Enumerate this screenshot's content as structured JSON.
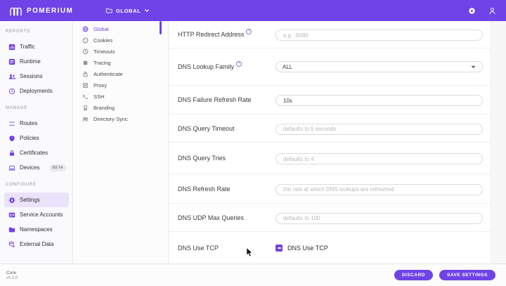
{
  "colors": {
    "accent": "#6F43E7",
    "accent_soft": "#EAE3FB"
  },
  "header": {
    "brand": "POMERIUM",
    "logo_icon": "pomerium-logo-icon",
    "namespace": {
      "icon": "folder-icon",
      "label": "GLOBAL",
      "chevron": "chevron-down-icon"
    },
    "actions": [
      {
        "icon": "gear-icon"
      },
      {
        "icon": "user-icon"
      }
    ]
  },
  "sidebar": {
    "sections": [
      {
        "label": "REPORTS",
        "items": [
          {
            "label": "Traffic",
            "icon": "traffic-icon"
          },
          {
            "label": "Runtime",
            "icon": "runtime-icon"
          },
          {
            "label": "Sessions",
            "icon": "sessions-icon"
          },
          {
            "label": "Deployments",
            "icon": "deployments-icon"
          }
        ]
      },
      {
        "label": "MANAGE",
        "items": [
          {
            "label": "Routes",
            "icon": "routes-icon"
          },
          {
            "label": "Policies",
            "icon": "policies-icon"
          },
          {
            "label": "Certificates",
            "icon": "certificates-icon"
          },
          {
            "label": "Devices",
            "icon": "devices-icon",
            "badge": "BETA"
          }
        ]
      },
      {
        "label": "CONFIGURE",
        "items": [
          {
            "label": "Settings",
            "icon": "settings-icon",
            "active": true
          },
          {
            "label": "Service Accounts",
            "icon": "service-accounts-icon"
          },
          {
            "label": "Namespaces",
            "icon": "namespaces-icon"
          },
          {
            "label": "External Data",
            "icon": "external-data-icon"
          }
        ]
      }
    ],
    "footer": {
      "edition": "Core",
      "version": "v0.0.0"
    }
  },
  "settings_nav": {
    "items": [
      {
        "label": "Global",
        "icon": "globe-icon",
        "active": true
      },
      {
        "label": "Cookies",
        "icon": "cookie-icon"
      },
      {
        "label": "Timeouts",
        "icon": "clock-icon"
      },
      {
        "label": "Tracing",
        "icon": "tracing-icon"
      },
      {
        "label": "Authenticate",
        "icon": "lock-icon"
      },
      {
        "label": "Proxy",
        "icon": "proxy-icon"
      },
      {
        "label": "SSH",
        "icon": "terminal-icon"
      },
      {
        "label": "Branding",
        "icon": "branding-icon"
      },
      {
        "label": "Directory Sync",
        "icon": "people-icon"
      }
    ]
  },
  "form": {
    "rows": [
      {
        "label": "HTTP Redirect Address",
        "info": true,
        "control": "input",
        "placeholder": "e.g. :8080",
        "value": ""
      },
      {
        "label": "DNS Lookup Family",
        "info": true,
        "control": "select",
        "value": "ALL"
      },
      {
        "label": "DNS Failure Refresh Rate",
        "control": "input",
        "placeholder": "",
        "value": "10s"
      },
      {
        "label": "DNS Query Timeout",
        "control": "input",
        "placeholder": "defaults to 5 seconds",
        "value": ""
      },
      {
        "label": "DNS Query Tries",
        "control": "input",
        "placeholder": "defaults to 4",
        "value": ""
      },
      {
        "label": "DNS Refresh Rate",
        "control": "input",
        "placeholder": "the rate at which DNS lookups are refreshed",
        "value": ""
      },
      {
        "label": "DNS UDP Max Queries",
        "control": "input",
        "placeholder": "defaults to 100",
        "value": ""
      },
      {
        "label": "DNS Use TCP",
        "control": "checkbox",
        "checkbox_label": "DNS Use TCP",
        "checked": true
      }
    ]
  },
  "action_bar": {
    "discard_label": "DISCARD",
    "save_label": "SAVE SETTINGS"
  }
}
